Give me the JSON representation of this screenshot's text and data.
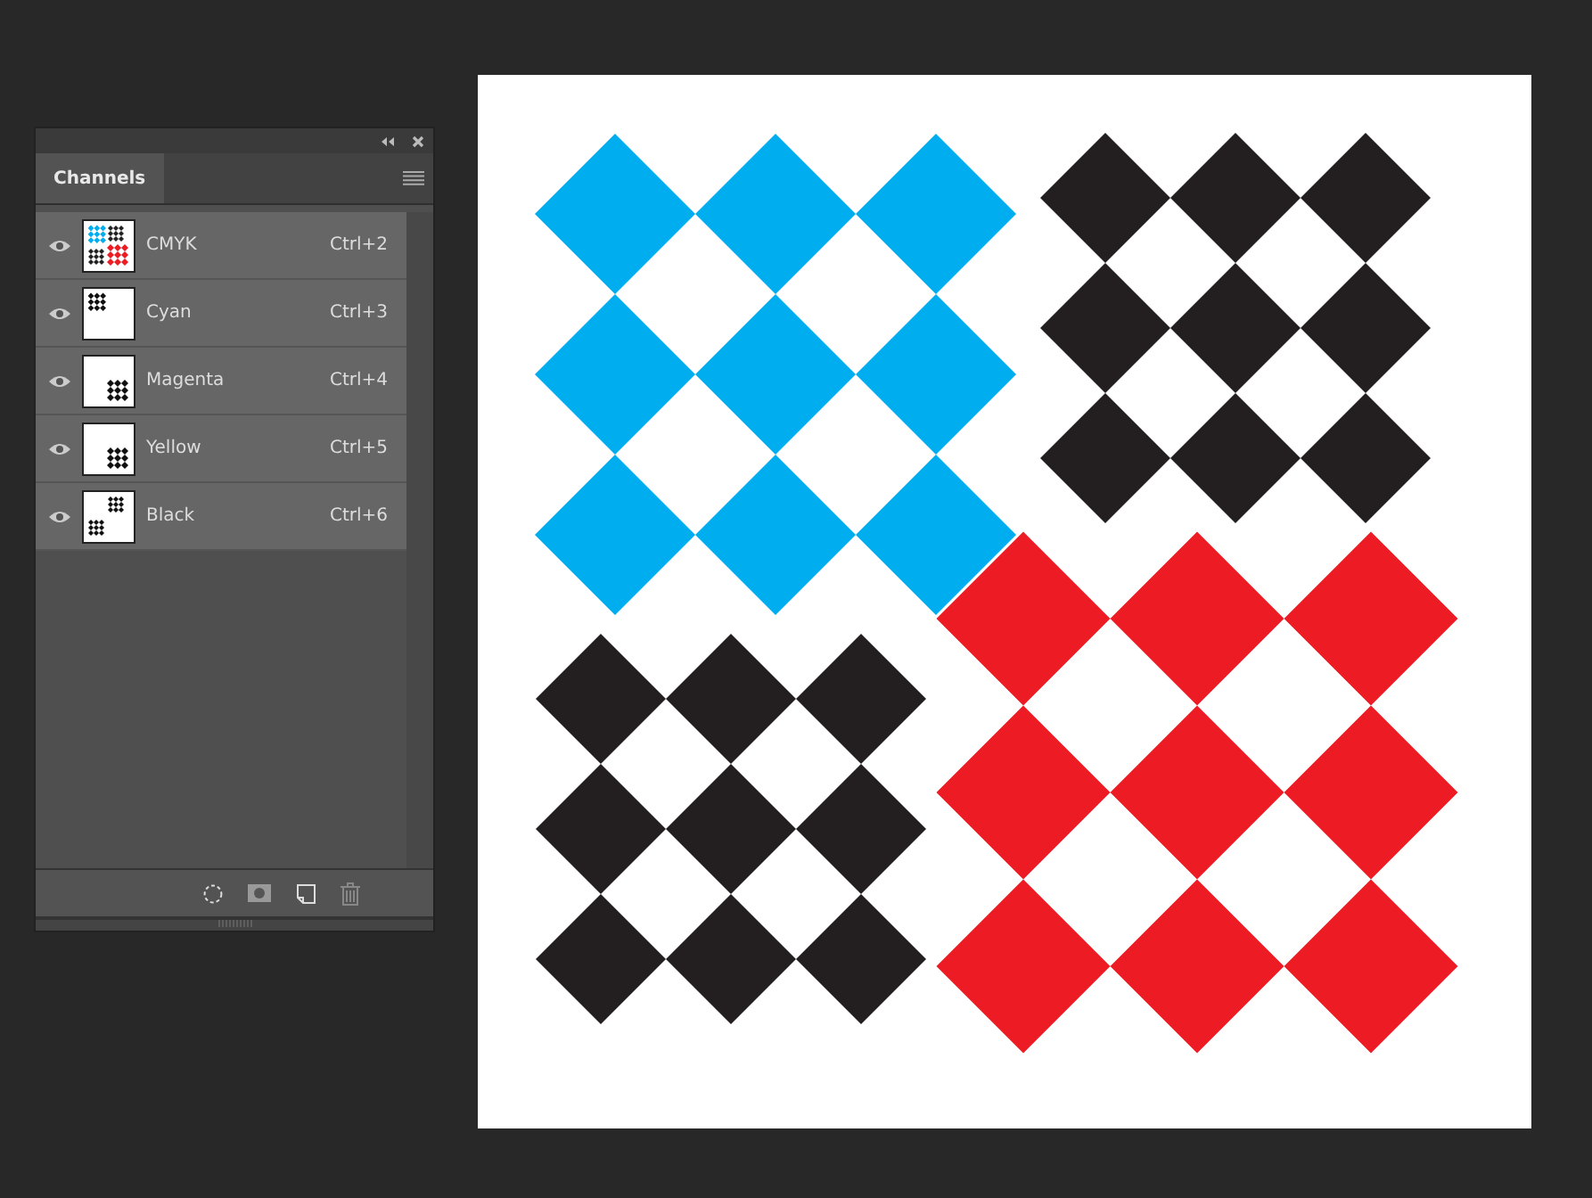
{
  "panel": {
    "tabs": [
      {
        "label": "Channels",
        "selected": true
      }
    ],
    "channels": [
      {
        "name": "CMYK",
        "shortcut": "Ctrl+2",
        "visible": true,
        "selected": true
      },
      {
        "name": "Cyan",
        "shortcut": "Ctrl+3",
        "visible": true,
        "selected": true
      },
      {
        "name": "Magenta",
        "shortcut": "Ctrl+4",
        "visible": true,
        "selected": true
      },
      {
        "name": "Yellow",
        "shortcut": "Ctrl+5",
        "visible": true,
        "selected": true
      },
      {
        "name": "Black",
        "shortcut": "Ctrl+6",
        "visible": true,
        "selected": true
      }
    ]
  }
}
